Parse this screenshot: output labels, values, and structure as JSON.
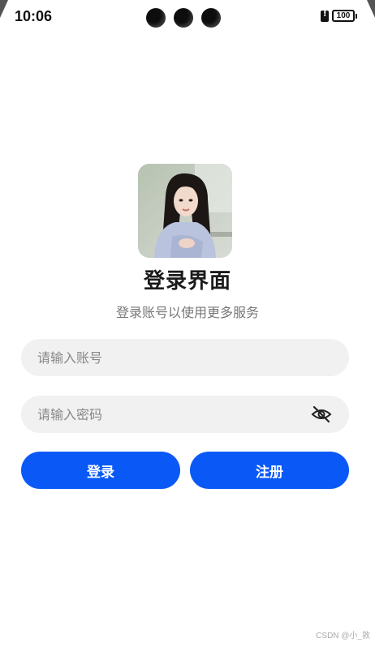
{
  "status_bar": {
    "time": "10:06",
    "battery": "100"
  },
  "login": {
    "title": "登录界面",
    "subtitle": "登录账号以使用更多服务",
    "account_placeholder": "请输入账号",
    "password_placeholder": "请输入密码",
    "login_label": "登录",
    "register_label": "注册"
  },
  "icons": {
    "password_toggle": "eye-off-icon",
    "avatar": "avatar-photo"
  },
  "colors": {
    "primary": "#0a59f7",
    "field_bg": "#f1f1f1"
  },
  "watermark": "CSDN @小_敦"
}
